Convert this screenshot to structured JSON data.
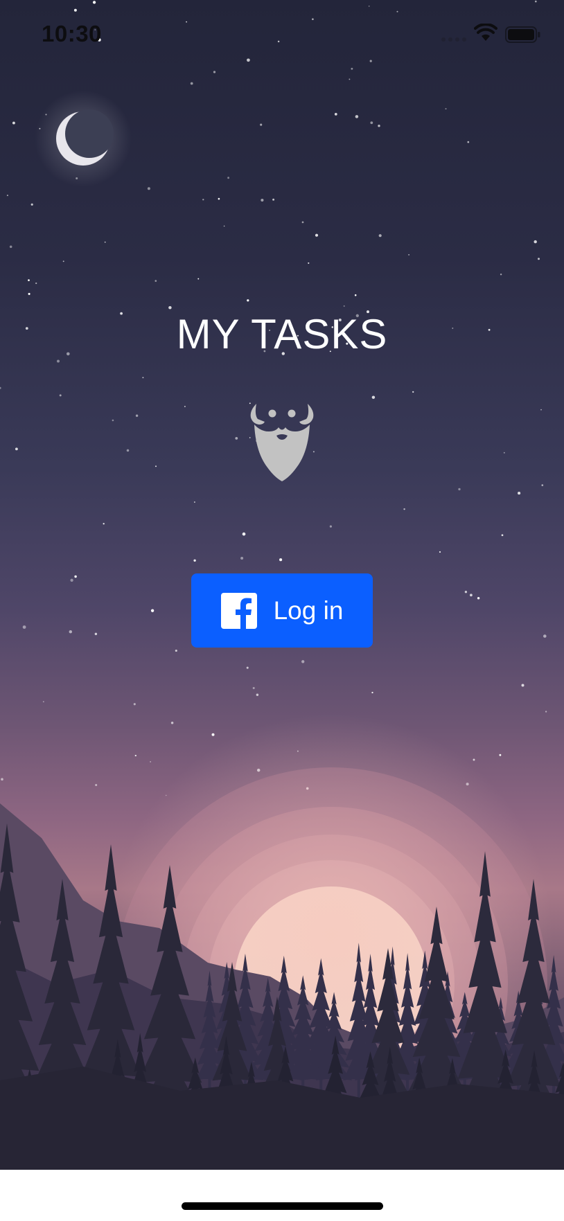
{
  "status_bar": {
    "time": "10:30",
    "icons": [
      "cellular-signal-icon",
      "wifi-icon",
      "battery-icon"
    ]
  },
  "app": {
    "title": "MY TASKS",
    "logo_icon": "bearded-face-icon",
    "background_icon": "night-forest-moon-scene"
  },
  "login": {
    "label": "Log in",
    "icon": "facebook-icon"
  },
  "colors": {
    "button": "#0b5fff",
    "title_text": "#ffffff",
    "logo": "#c2c2c2"
  }
}
